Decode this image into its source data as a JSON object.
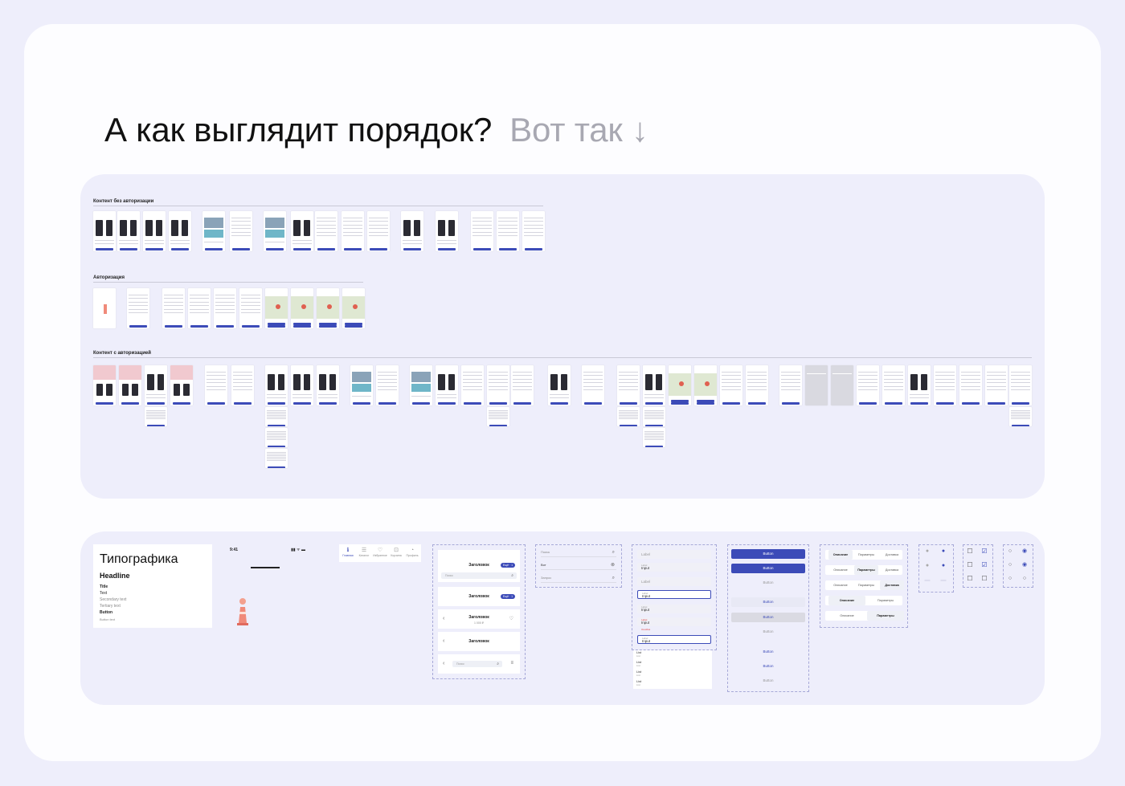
{
  "heading": {
    "main": "А как выглядит порядок?",
    "secondary": "Вот так ↓"
  },
  "flows": {
    "section1": "Контент без авторизации",
    "section2": "Авторизация",
    "section3": "Контент с авторизацией"
  },
  "typography": {
    "title": "Типографика",
    "headline": "Headline",
    "title_sample": "Title",
    "text_sample": "Text",
    "secondary_text": "Secondary text",
    "tertiary_text": "Tertiary text",
    "button_sample": "Button",
    "button_secondary": "Button text"
  },
  "phone": {
    "time": "9:41",
    "status": "▮▮ ᯤ ▬"
  },
  "tabbar": {
    "items": [
      "Главная",
      "Каталог",
      "Избранное",
      "Корзина",
      "Профиль"
    ],
    "active": "Главная"
  },
  "headers": {
    "title1": "Заголовок",
    "pill1": "Ещё · 1",
    "title2": "Заголовок",
    "pill2": "Ещё · 1",
    "title3": "Заголовок",
    "subtitle3": "1 000 ₽",
    "title4": "Заголовок",
    "search_placeholder": "Поиск",
    "search_placeholder2": "Поиск"
  },
  "search_variants": {
    "empty": "Поиск",
    "typing": "Вот",
    "result": "Запрос"
  },
  "inputs": {
    "label": "Label",
    "input": "Input",
    "error": "Ошибка",
    "list_item": "List",
    "list_sub": "List"
  },
  "buttons": {
    "label": "Button"
  },
  "tabs": {
    "a": "Описание",
    "b": "Параметры",
    "c": "Доставка"
  }
}
